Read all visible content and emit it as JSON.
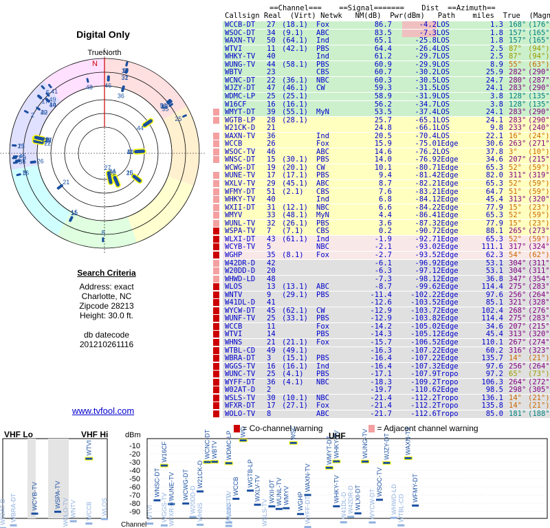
{
  "title": "Digital Only",
  "north_label": "TrueNorth",
  "north_mark": "N",
  "criteria": {
    "heading": "Search Criteria",
    "address": "Address: exact",
    "city": "Charlotte, NC",
    "zip": "Zipcode 28213",
    "height": "Height: 30.0 ft.",
    "dbcode_label": "db datecode",
    "dbcode": "201210261116"
  },
  "link": "www.tvfool.com",
  "table_headers": {
    "line1": "==Channel===    ==Signal=======    Dist  ==Azimuth==",
    "line2": "Callsign Real  (Virt) Netwk   NM(dB)  Pwr(dBm)   Path    miles  True  (Magn)"
  },
  "colors": {
    "green": "#ccf0cc",
    "yellow": "#ffffc0",
    "pink": "#f8e8e8",
    "gray": "#e0e0e0",
    "co_warning": "#cc0000",
    "adj_warning": "#f4a0a0"
  },
  "stations": [
    [
      "WCCB-DT",
      "27",
      "(18.1)",
      "Fox",
      "86.7",
      "-4.2",
      "LOS",
      "1.3",
      "168°",
      "(176°)",
      "green",
      ""
    ],
    [
      "WSOC-DT",
      "34",
      "(9.1)",
      "ABC",
      "83.5",
      "-7.3",
      "LOS",
      "1.8",
      "157°",
      "(165°)",
      "green",
      ""
    ],
    [
      "WAXN-TV",
      "50",
      "(64.1)",
      "Ind",
      "65.1",
      "-25.8",
      "LOS",
      "1.8",
      "157°",
      "(165°)",
      "green",
      ""
    ],
    [
      "WTVI",
      "11",
      "(42.1)",
      "PBS",
      "64.4",
      "-26.4",
      "LOS",
      "2.5",
      "87°",
      "(94°)",
      "green",
      ""
    ],
    [
      "WHKY-TV",
      "40",
      "",
      "Ind",
      "61.2",
      "-29.7",
      "LOS",
      "2.5",
      "87°",
      "(94°)",
      "green",
      ""
    ],
    [
      "WUNG-TV",
      "44",
      "(58.1)",
      "PBS",
      "60.9",
      "-29.9",
      "LOS",
      "8.9",
      "55°",
      "(63°)",
      "green",
      ""
    ],
    [
      "WBTV",
      "23",
      "",
      "CBS",
      "60.7",
      "-30.2",
      "LOS",
      "25.9",
      "282°",
      "(290°)",
      "green",
      ""
    ],
    [
      "WCNC-DT",
      "22",
      "(36.1)",
      "NBC",
      "60.3",
      "-30.5",
      "LOS",
      "24.7",
      "280°",
      "(287°)",
      "green",
      ""
    ],
    [
      "WJZY-DT",
      "47",
      "(46.1)",
      "CW",
      "59.3",
      "-31.5",
      "LOS",
      "24.1",
      "283°",
      "(290°)",
      "green",
      ""
    ],
    [
      "WDMC-LP",
      "25",
      "(25.1)",
      "",
      "58.9",
      "-31.9",
      "LOS",
      "3.8",
      "128°",
      "(135°)",
      "green",
      ""
    ],
    [
      "W16CF",
      "16",
      "(16.1)",
      "",
      "56.2",
      "-34.7",
      "LOS",
      "3.8",
      "128°",
      "(135°)",
      "green",
      ""
    ],
    [
      "WMYT-DT",
      "39",
      "(55.1)",
      "MyN",
      "53.5",
      "-37.4",
      "LOS",
      "24.1",
      "283°",
      "(290°)",
      "green",
      "adj"
    ],
    [
      "WGTB-LP",
      "28",
      "(28.1)",
      "",
      "25.7",
      "-65.1",
      "LOS",
      "24.1",
      "283°",
      "(290°)",
      "yellow",
      "adj"
    ],
    [
      "W21CK-D",
      "21",
      "",
      "",
      "24.8",
      "-66.1",
      "LOS",
      "9.8",
      "233°",
      "(240°)",
      "yellow",
      ""
    ],
    [
      "WAXN-TV",
      "36",
      "",
      "Ind",
      "20.5",
      "-70.4",
      "LOS",
      "22.1",
      "16°",
      "(24°)",
      "yellow",
      "adj"
    ],
    [
      "WCCB",
      "26",
      "",
      "Fox",
      "15.9",
      "-75.0",
      "1Edge",
      "30.6",
      "263°",
      "(271°)",
      "yellow",
      "adj"
    ],
    [
      "WSOC-TV",
      "46",
      "",
      "ABC",
      "14.6",
      "-76.2",
      "LOS",
      "37.8",
      "3°",
      "(10°)",
      "yellow",
      "adj"
    ],
    [
      "WNSC-DT",
      "15",
      "(30.1)",
      "PBS",
      "14.0",
      "-76.9",
      "2Edge",
      "34.6",
      "207°",
      "(215°)",
      "yellow",
      "adj"
    ],
    [
      "WCWG-DT",
      "19",
      "(20.1)",
      "CW",
      "10.1",
      "-80.7",
      "1Edge",
      "65.3",
      "52°",
      "(59°)",
      "yellow",
      ""
    ],
    [
      "WUNE-TV",
      "17",
      "(17.1)",
      "PBS",
      "9.4",
      "-81.4",
      "2Edge",
      "82.0",
      "311°",
      "(319°)",
      "yellow",
      "adj"
    ],
    [
      "WXLV-TV",
      "29",
      "(45.1)",
      "ABC",
      "8.7",
      "-82.2",
      "1Edge",
      "65.3",
      "52°",
      "(59°)",
      "yellow",
      "adj"
    ],
    [
      "WFMY-DT",
      "51",
      "(2.1)",
      "CBS",
      "7.6",
      "-83.2",
      "1Edge",
      "64.7",
      "51°",
      "(59°)",
      "yellow",
      "adj"
    ],
    [
      "WHKY-TV",
      "40",
      "",
      "Ind",
      "6.8",
      "-84.1",
      "2Edge",
      "45.4",
      "313°",
      "(320°)",
      "yellow",
      "adj"
    ],
    [
      "WXII-DT",
      "31",
      "(12.1)",
      "NBC",
      "6.6",
      "-84.2",
      "2Edge",
      "77.9",
      "15°",
      "(23°)",
      "yellow",
      "adj"
    ],
    [
      "WMYV",
      "33",
      "(48.1)",
      "MyN",
      "4.4",
      "-86.4",
      "1Edge",
      "65.3",
      "52°",
      "(59°)",
      "yellow",
      "adj"
    ],
    [
      "WUNL-TV",
      "32",
      "(26.1)",
      "PBS",
      "3.6",
      "-87.3",
      "2Edge",
      "77.9",
      "15°",
      "(23°)",
      "yellow",
      "adj"
    ],
    [
      "WSPA-TV",
      "7",
      "(7.1)",
      "CBS",
      "0.2",
      "-90.7",
      "2Edge",
      "88.1",
      "265°",
      "(273°)",
      "yellow",
      "co"
    ],
    [
      "WLXI-DT",
      "43",
      "(61.1)",
      "Ind",
      "-1.9",
      "-92.7",
      "1Edge",
      "65.3",
      "52°",
      "(59°)",
      "pink",
      "co"
    ],
    [
      "WCYB-TV",
      "5",
      "",
      "NBC",
      "-2.1",
      "-93.0",
      "2Edge",
      "111.1",
      "317°",
      "(324°)",
      "pink",
      "co"
    ],
    [
      "WGHP",
      "35",
      "(8.1)",
      "Fox",
      "-2.7",
      "-93.5",
      "2Edge",
      "62.3",
      "54°",
      "(62°)",
      "pink",
      "co"
    ],
    [
      "W42DR-D",
      "42",
      "",
      "",
      "-6.1",
      "-96.9",
      "2Edge",
      "53.1",
      "304°",
      "(311°)",
      "gray",
      "adj"
    ],
    [
      "W20DD-D",
      "20",
      "",
      "",
      "-6.3",
      "-97.1",
      "2Edge",
      "53.1",
      "304°",
      "(311°)",
      "gray",
      "adj"
    ],
    [
      "WHWD-LD",
      "48",
      "",
      "",
      "-7.3",
      "-98.1",
      "2Edge",
      "36.8",
      "347°",
      "(354°)",
      "gray",
      "adj"
    ],
    [
      "WLOS",
      "13",
      "(13.1)",
      "ABC",
      "-8.7",
      "-99.6",
      "2Edge",
      "114.4",
      "275°",
      "(283°)",
      "gray",
      "co"
    ],
    [
      "WNTV",
      "9",
      "(29.1)",
      "PBS",
      "-11.4",
      "-102.2",
      "2Edge",
      "97.6",
      "256°",
      "(264°)",
      "gray",
      "co"
    ],
    [
      "W41DL-D",
      "41",
      "",
      "",
      "-12.6",
      "-103.5",
      "2Edge",
      "85.1",
      "321°",
      "(328°)",
      "gray",
      "co"
    ],
    [
      "WYCW-DT",
      "45",
      "(62.1)",
      "CW",
      "-12.9",
      "-103.7",
      "2Edge",
      "102.4",
      "268°",
      "(276°)",
      "gray",
      "co"
    ],
    [
      "WUNF-TV",
      "25",
      "(33.1)",
      "PBS",
      "-12.9",
      "-103.8",
      "2Edge",
      "114.4",
      "275°",
      "(283°)",
      "gray",
      "co"
    ],
    [
      "WCCB",
      "11",
      "",
      "Fox",
      "-14.2",
      "-105.0",
      "2Edge",
      "34.6",
      "207°",
      "(215°)",
      "gray",
      "co"
    ],
    [
      "WTVI",
      "14",
      "",
      "PBS",
      "-14.3",
      "-105.1",
      "2Edge",
      "45.4",
      "313°",
      "(320°)",
      "gray",
      "co"
    ],
    [
      "WHNS",
      "21",
      "(21.1)",
      "Fox",
      "-15.7",
      "-106.5",
      "2Edge",
      "110.1",
      "267°",
      "(274°)",
      "gray",
      "co"
    ],
    [
      "WTBL-CD",
      "49",
      "(49.1)",
      "",
      "-16.3",
      "-107.2",
      "2Edge",
      "60.2",
      "316°",
      "(323°)",
      "gray",
      "co"
    ],
    [
      "WBRA-DT",
      "3",
      "(15.1)",
      "PBS",
      "-16.4",
      "-107.2",
      "2Edge",
      "135.7",
      "14°",
      "(21°)",
      "gray",
      "co"
    ],
    [
      "WGGS-TV",
      "16",
      "(16.1)",
      "Ind",
      "-16.4",
      "-107.3",
      "2Edge",
      "97.6",
      "256°",
      "(264°)",
      "gray",
      "co"
    ],
    [
      "WUNC-TV",
      "25",
      "(4.1)",
      "PBS",
      "-17.1",
      "-107.9",
      "Tropo",
      "97.2",
      "65°",
      "(73°)",
      "gray",
      "co"
    ],
    [
      "WYFF-DT",
      "36",
      "(4.1)",
      "NBC",
      "-18.3",
      "-109.2",
      "Tropo",
      "106.3",
      "264°",
      "(272°)",
      "gray",
      "co"
    ],
    [
      "W02AT-D",
      "2",
      "",
      "",
      "-19.7",
      "-110.6",
      "2Edge",
      "98.5",
      "298°",
      "(305°)",
      "gray",
      "co"
    ],
    [
      "WSLS-TV",
      "30",
      "(10.1)",
      "NBC",
      "-21.4",
      "-112.2",
      "Tropo",
      "136.1",
      "14°",
      "(21°)",
      "gray",
      "co"
    ],
    [
      "WFXR-DT",
      "17",
      "(27.1)",
      "Fox",
      "-21.4",
      "-112.2",
      "Tropo",
      "135.8",
      "14°",
      "(21°)",
      "gray",
      "co"
    ],
    [
      "WOLO-TV",
      "8",
      "",
      "ABC",
      "-21.7",
      "-112.6",
      "Tropo",
      "85.0",
      "181°",
      "(188°)",
      "gray",
      "co"
    ]
  ],
  "legend": {
    "co": "= Co-channel warning",
    "adj": "= Adjacent channel warning"
  },
  "bottom": {
    "vhf_lo": "VHF Lo",
    "vhf_hi": "VHF Hi",
    "uhf": "UHF",
    "dbm": "dBm",
    "channel": "Channel",
    "ylabels": [
      "-10",
      "-20",
      "-30",
      "-40",
      "-50",
      "-60",
      "-70",
      "-80",
      "-90"
    ]
  }
}
